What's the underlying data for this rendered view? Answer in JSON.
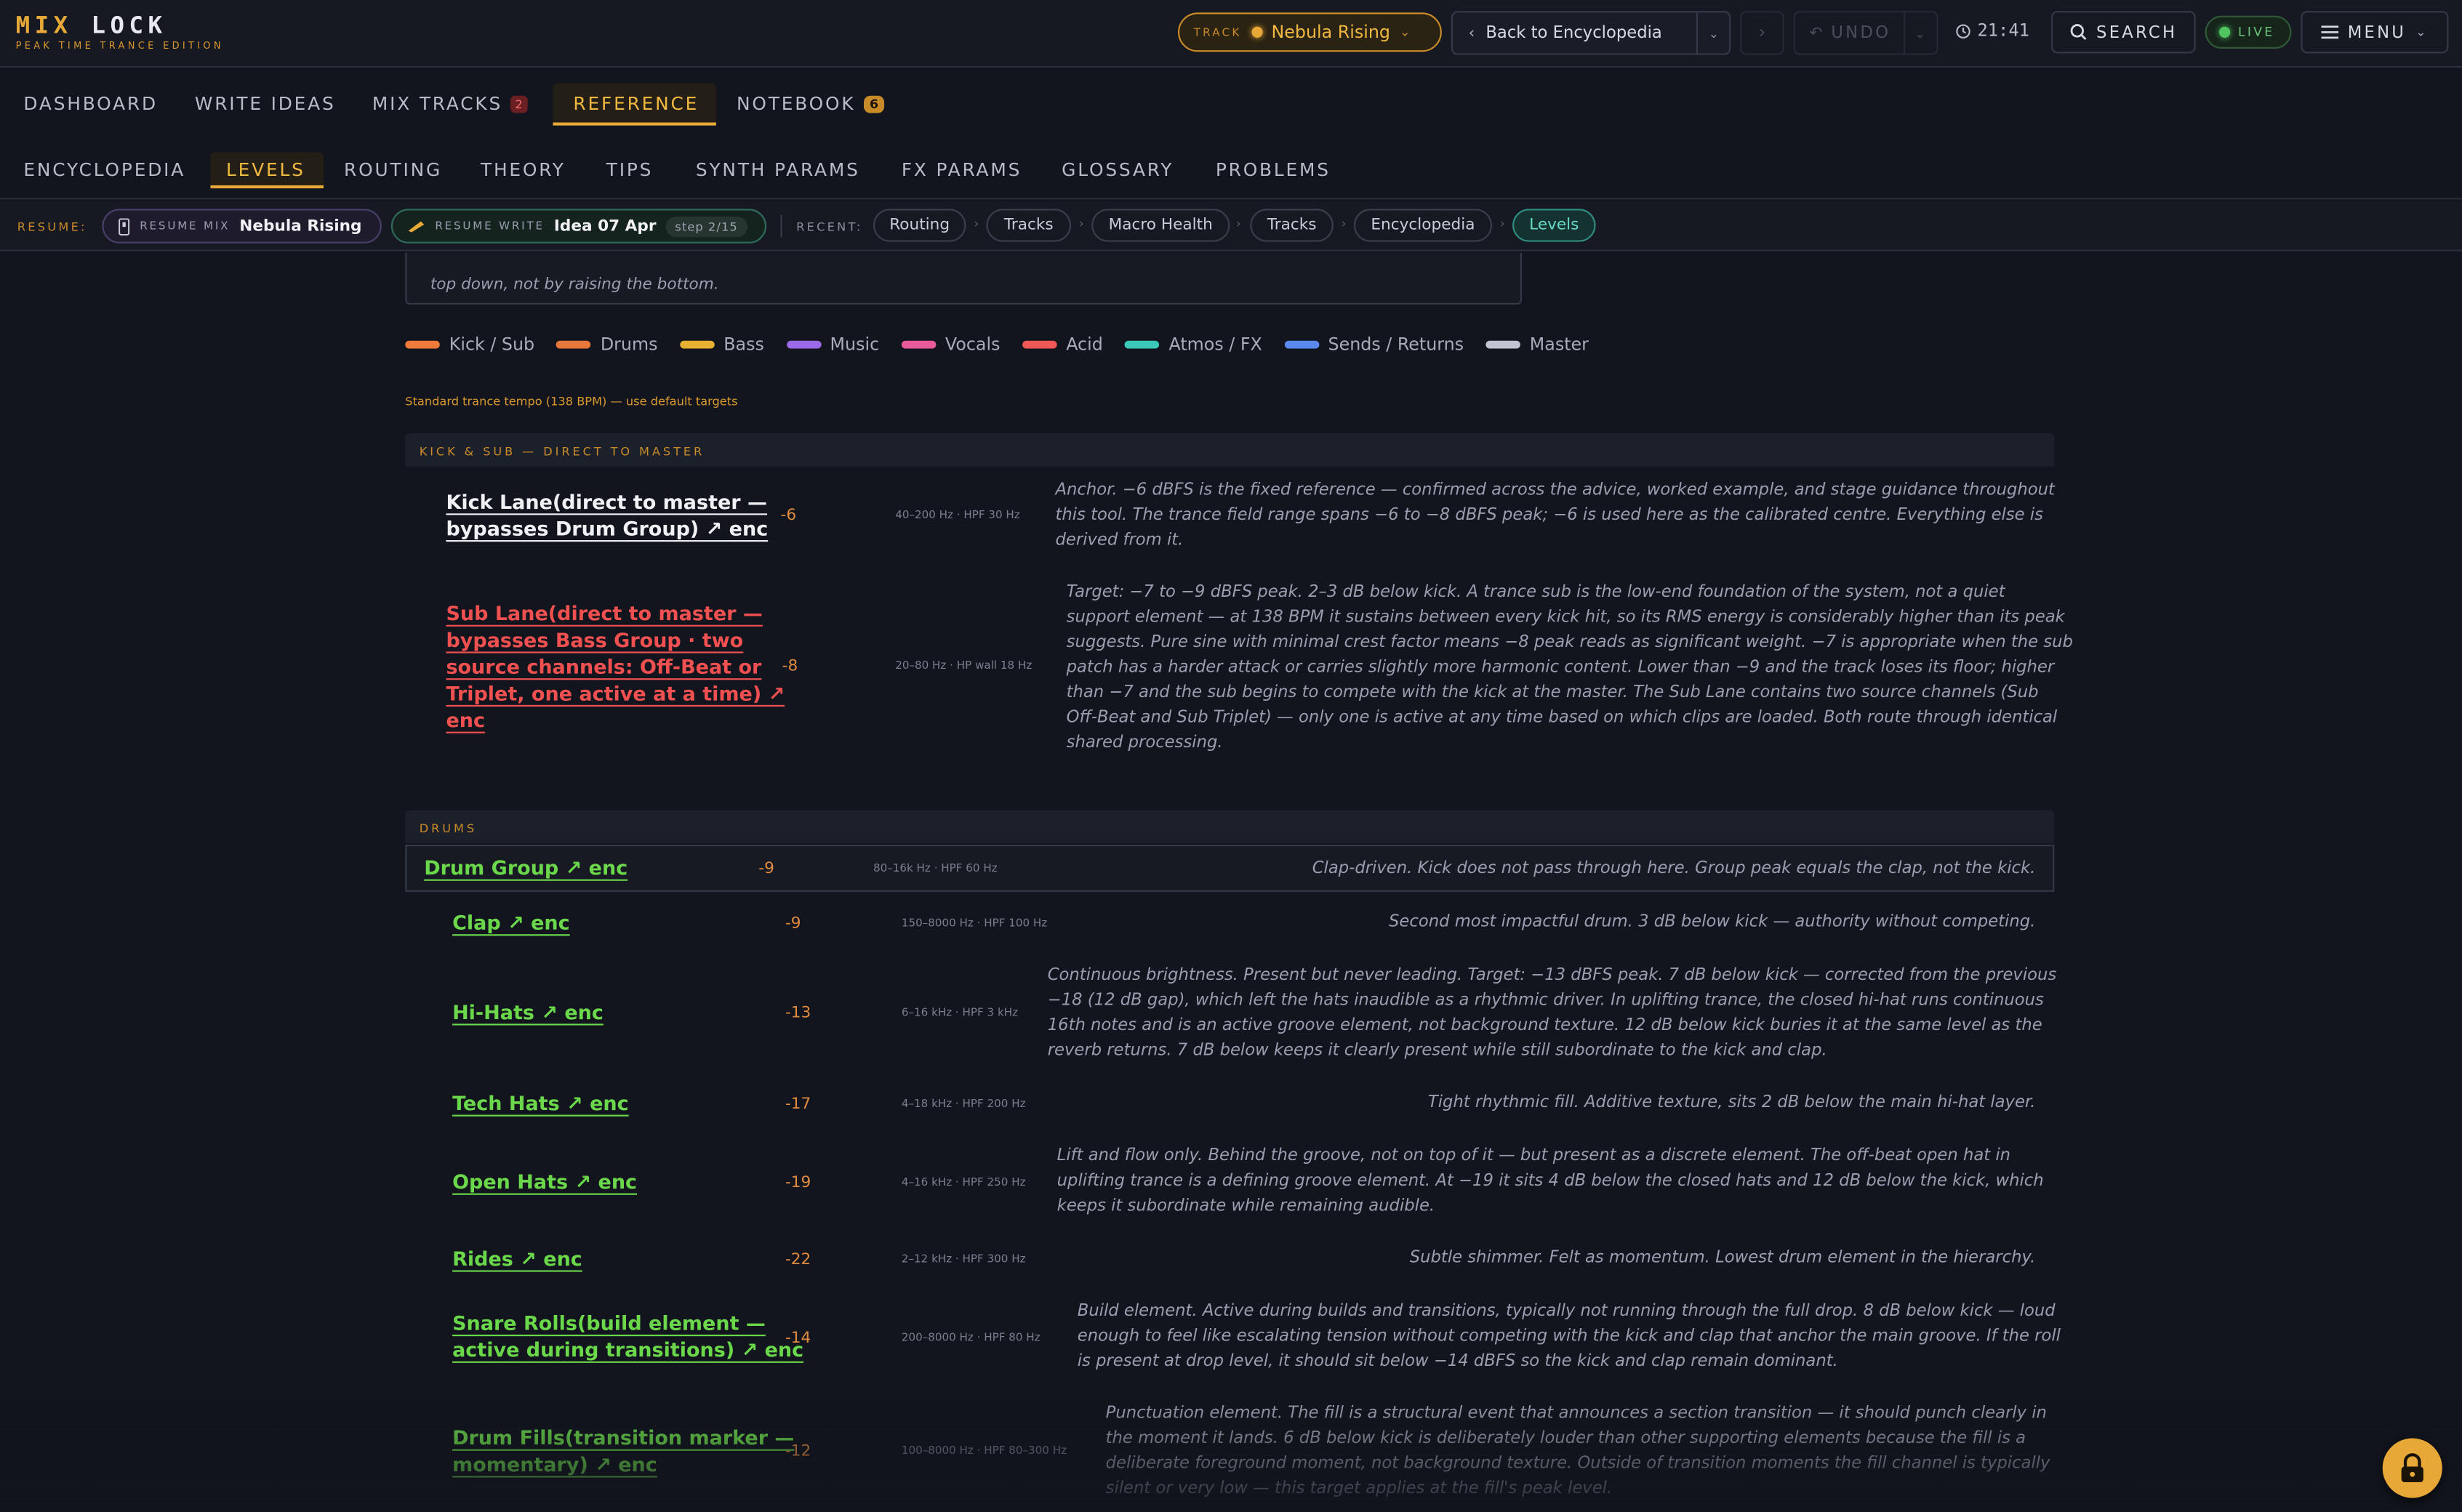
{
  "app": {
    "title_mix": "MIX",
    "title_lock": "LOCK",
    "subtitle": "PEAK TIME TRANCE EDITION"
  },
  "topbar": {
    "track_label": "TRACK",
    "track_value": "Nebula Rising",
    "back_label": "Back to Encyclopedia",
    "forward_glyph": "›",
    "undo_label": "UNDO",
    "clock": "21:41",
    "search_label": "SEARCH",
    "live_label": "LIVE",
    "menu_label": "MENU"
  },
  "main_nav": {
    "items": [
      {
        "label": "DASHBOARD"
      },
      {
        "label": "WRITE IDEAS"
      },
      {
        "label": "MIX TRACKS",
        "badge": "2"
      },
      {
        "label": "REFERENCE",
        "active": true
      },
      {
        "label": "NOTEBOOK",
        "badge": "6"
      }
    ]
  },
  "sub_nav": {
    "items": [
      {
        "label": "ENCYCLOPEDIA"
      },
      {
        "label": "LEVELS",
        "active": true
      },
      {
        "label": "ROUTING"
      },
      {
        "label": "THEORY"
      },
      {
        "label": "TIPS"
      },
      {
        "label": "SYNTH PARAMS"
      },
      {
        "label": "FX PARAMS"
      },
      {
        "label": "GLOSSARY"
      },
      {
        "label": "PROBLEMS"
      }
    ]
  },
  "resume": {
    "label": "RESUME:",
    "mix_key": "RESUME MIX",
    "mix_value": "Nebula Rising",
    "write_key": "RESUME WRITE",
    "write_value": "Idea 07 Apr",
    "write_step": "step 2/15",
    "recent_label": "RECENT:",
    "recent": [
      "Routing",
      "Tracks",
      "Macro Health",
      "Tracks",
      "Encyclopedia",
      "Levels"
    ]
  },
  "content": {
    "note_tail": "top down, not by raising the bottom.",
    "legend": [
      {
        "label": "Kick / Sub",
        "color": "#f07a3a"
      },
      {
        "label": "Drums",
        "color": "#e8783a"
      },
      {
        "label": "Bass",
        "color": "#e8b030"
      },
      {
        "label": "Music",
        "color": "#9a6ae8"
      },
      {
        "label": "Vocals",
        "color": "#e85a9a"
      },
      {
        "label": "Acid",
        "color": "#f05858"
      },
      {
        "label": "Atmos / FX",
        "color": "#3ac8b8"
      },
      {
        "label": "Sends / Returns",
        "color": "#5a8af0"
      },
      {
        "label": "Master",
        "color": "#c0c4d0"
      }
    ],
    "tempo_note": "Standard trance tempo (138 BPM) — use default targets",
    "sections": {
      "kick_sub": "KICK & SUB — DIRECT TO MASTER",
      "drums": "DRUMS"
    },
    "rows": {
      "kick": {
        "name1": "Kick Lane(direct to master —",
        "name2": "bypasses Drum Group) ↗ enc",
        "value": "-6",
        "freq": "40–200 Hz · HPF 30 Hz",
        "desc1": "Anchor. −6 dBFS is the fixed reference — confirmed across the advice, worked example, and stage guidance throughout",
        "desc2": "this tool. The trance field range spans −6 to −8 dBFS peak; −6 is used here as the calibrated centre. Everything else is",
        "desc3": "derived from it."
      },
      "sub": {
        "name1": "Sub Lane(direct to master —",
        "name2": "bypasses Bass Group · two",
        "name3": "source channels: Off-Beat or",
        "name4": "Triplet, one active at a time) ↗",
        "name5": "enc",
        "value": "-8",
        "freq": "20–80 Hz · HP wall 18 Hz",
        "desc1": "Target: −7 to −9 dBFS peak. 2–3 dB below kick. A trance sub is the low-end foundation of the system, not a quiet",
        "desc2": "support element — at 138 BPM it sustains between every kick hit, so its RMS energy is considerably higher than its peak",
        "desc3": "suggests. Pure sine with minimal crest factor means −8 peak reads as significant weight. −7 is appropriate when the sub",
        "desc4": "patch has a harder attack or carries slightly more harmonic content. Lower than −9 and the track loses its floor; higher",
        "desc5": "than −7 and the sub begins to compete with the kick at the master. The Sub Lane contains two source channels (Sub",
        "desc6": "Off-Beat and Sub Triplet) — only one is active at any time based on which clips are loaded. Both route through identical",
        "desc7": "shared processing."
      },
      "drum_group": {
        "name": "Drum Group ↗ enc",
        "value": "-9",
        "freq": "80–16k Hz · HPF 60 Hz",
        "desc": "Clap-driven. Kick does not pass through here. Group peak equals the clap, not the kick."
      },
      "clap": {
        "name": "Clap ↗ enc",
        "value": "-9",
        "freq": "150–8000 Hz · HPF 100 Hz",
        "desc": "Second most impactful drum. 3 dB below kick — authority without competing."
      },
      "hihats": {
        "name": "Hi-Hats ↗ enc",
        "value": "-13",
        "freq": "6–16 kHz · HPF 3 kHz",
        "desc1": "Continuous brightness. Present but never leading. Target: −13 dBFS peak. 7 dB below kick — corrected from the previous",
        "desc2": "−18 (12 dB gap), which left the hats inaudible as a rhythmic driver. In uplifting trance, the closed hi-hat runs continuous",
        "desc3": "16th notes and is an active groove element, not background texture. 12 dB below kick buries it at the same level as the",
        "desc4": "reverb returns. 7 dB below keeps it clearly present while still subordinate to the kick and clap."
      },
      "techhats": {
        "name": "Tech Hats ↗ enc",
        "value": "-17",
        "freq": "4–18 kHz · HPF 200 Hz",
        "desc": "Tight rhythmic fill. Additive texture, sits 2 dB below the main hi-hat layer."
      },
      "openhats": {
        "name": "Open Hats ↗ enc",
        "value": "-19",
        "freq": "4–16 kHz · HPF 250 Hz",
        "desc1": "Lift and flow only. Behind the groove, not on top of it — but present as a discrete element. The off-beat open hat in",
        "desc2": "uplifting trance is a defining groove element. At −19 it sits 4 dB below the closed hats and 12 dB below the kick, which",
        "desc3": "keeps it subordinate while remaining audible."
      },
      "rides": {
        "name": "Rides ↗ enc",
        "value": "-22",
        "freq": "2–12 kHz · HPF 300 Hz",
        "desc": "Subtle shimmer. Felt as momentum. Lowest drum element in the hierarchy."
      },
      "snarerolls": {
        "name1": "Snare Rolls(build element —",
        "name2": "active during transitions) ↗ enc",
        "value": "-14",
        "freq": "200–8000 Hz · HPF 80 Hz",
        "desc1": "Build element. Active during builds and transitions, typically not running through the full drop. 8 dB below kick — loud",
        "desc2": "enough to feel like escalating tension without competing with the kick and clap that anchor the main groove. If the roll",
        "desc3": "is present at drop level, it should sit below −14 dBFS so the kick and clap remain dominant."
      },
      "drumfills": {
        "name1": "Drum Fills(transition marker —",
        "name2": "momentary) ↗ enc",
        "value": "-12",
        "freq": "100–8000 Hz · HPF 80–300 Hz",
        "desc1": "Punctuation element. The fill is a structural event that announces a section transition — it should punch clearly in",
        "desc2": "the moment it lands. 6 dB below kick is deliberately louder than other supporting elements because the fill is a",
        "desc3": "deliberate foreground moment, not background texture. Outside of transition moments the fill channel is typically",
        "desc4": "silent or very low — this target applies at the fill's peak level."
      }
    }
  }
}
